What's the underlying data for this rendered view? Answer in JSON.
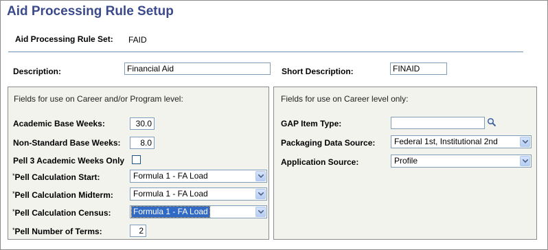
{
  "page": {
    "title": "Aid Processing Rule Setup"
  },
  "header": {
    "rule_set_label": "Aid Processing Rule Set:",
    "rule_set_value": "FAID",
    "description_label": "Description:",
    "description_value": "Financial Aid",
    "short_description_label": "Short Description:",
    "short_description_value": "FINAID"
  },
  "left_group": {
    "title": "Fields for use on Career and/or Program level:",
    "academic_base_weeks_label": "Academic Base Weeks:",
    "academic_base_weeks_value": "30.0",
    "non_standard_base_weeks_label": "Non-Standard Base Weeks:",
    "non_standard_base_weeks_value": "8.0",
    "pell3_label": "Pell 3 Academic Weeks Only",
    "pell3_checked": false,
    "required_marker": "*",
    "pell_start_label": "Pell Calculation Start:",
    "pell_start_value": "Formula 1 - FA Load",
    "pell_midterm_label": "Pell Calculation Midterm:",
    "pell_midterm_value": "Formula 1 - FA Load",
    "pell_census_label": "Pell Calculation Census:",
    "pell_census_value": "Formula 1 - FA Load",
    "pell_terms_label": "Pell Number of Terms:",
    "pell_terms_value": "2"
  },
  "right_group": {
    "title": "Fields for use on Career level only:",
    "gap_item_type_label": "GAP Item Type:",
    "gap_item_type_value": "",
    "packaging_source_label": "Packaging Data Source:",
    "packaging_source_value": "Federal 1st, Institutional 2nd",
    "application_source_label": "Application Source:",
    "application_source_value": "Profile"
  },
  "icons": {
    "lookup": "search-icon",
    "dropdown": "chevron-down-icon"
  },
  "colors": {
    "title": "#3a4a8a",
    "group_bg": "#f1f3ec",
    "selection": "#316ac5"
  }
}
